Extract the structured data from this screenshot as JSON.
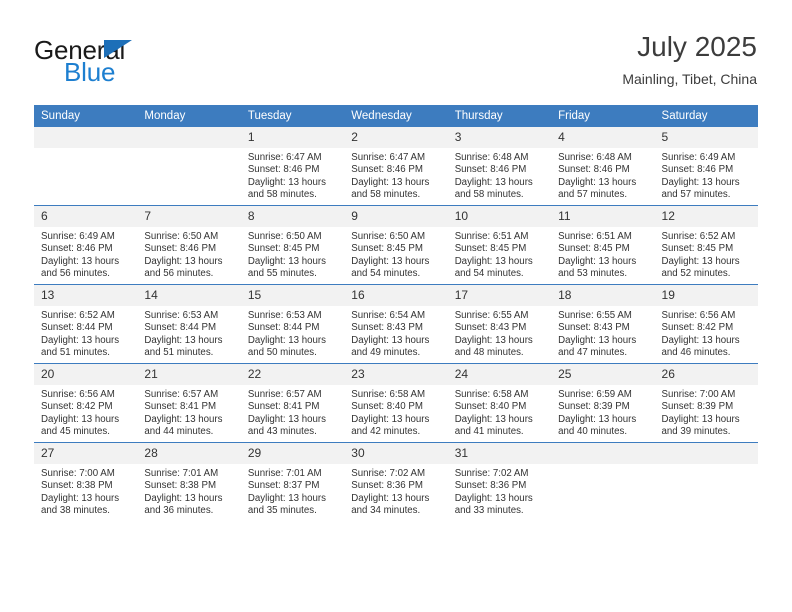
{
  "brand": {
    "name_top": "General",
    "name_bottom": "Blue",
    "accent_color": "#1d7fd0",
    "triangle_color": "#1d6fb8"
  },
  "header": {
    "title": "July 2025",
    "location": "Mainling, Tibet, China"
  },
  "theme": {
    "header_blue": "#3d7cbf",
    "daynum_bg": "#f2f2f2",
    "text": "#333333"
  },
  "weekday_headers": [
    "Sunday",
    "Monday",
    "Tuesday",
    "Wednesday",
    "Thursday",
    "Friday",
    "Saturday"
  ],
  "labels": {
    "sunrise_prefix": "Sunrise:",
    "sunset_prefix": "Sunset:",
    "daylight_prefix": "Daylight:"
  },
  "weeks": [
    [
      {
        "day": "",
        "sunrise": "",
        "sunset": "",
        "daylight": ""
      },
      {
        "day": "",
        "sunrise": "",
        "sunset": "",
        "daylight": ""
      },
      {
        "day": "1",
        "sunrise": "Sunrise: 6:47 AM",
        "sunset": "Sunset: 8:46 PM",
        "daylight": "Daylight: 13 hours and 58 minutes."
      },
      {
        "day": "2",
        "sunrise": "Sunrise: 6:47 AM",
        "sunset": "Sunset: 8:46 PM",
        "daylight": "Daylight: 13 hours and 58 minutes."
      },
      {
        "day": "3",
        "sunrise": "Sunrise: 6:48 AM",
        "sunset": "Sunset: 8:46 PM",
        "daylight": "Daylight: 13 hours and 58 minutes."
      },
      {
        "day": "4",
        "sunrise": "Sunrise: 6:48 AM",
        "sunset": "Sunset: 8:46 PM",
        "daylight": "Daylight: 13 hours and 57 minutes."
      },
      {
        "day": "5",
        "sunrise": "Sunrise: 6:49 AM",
        "sunset": "Sunset: 8:46 PM",
        "daylight": "Daylight: 13 hours and 57 minutes."
      }
    ],
    [
      {
        "day": "6",
        "sunrise": "Sunrise: 6:49 AM",
        "sunset": "Sunset: 8:46 PM",
        "daylight": "Daylight: 13 hours and 56 minutes."
      },
      {
        "day": "7",
        "sunrise": "Sunrise: 6:50 AM",
        "sunset": "Sunset: 8:46 PM",
        "daylight": "Daylight: 13 hours and 56 minutes."
      },
      {
        "day": "8",
        "sunrise": "Sunrise: 6:50 AM",
        "sunset": "Sunset: 8:45 PM",
        "daylight": "Daylight: 13 hours and 55 minutes."
      },
      {
        "day": "9",
        "sunrise": "Sunrise: 6:50 AM",
        "sunset": "Sunset: 8:45 PM",
        "daylight": "Daylight: 13 hours and 54 minutes."
      },
      {
        "day": "10",
        "sunrise": "Sunrise: 6:51 AM",
        "sunset": "Sunset: 8:45 PM",
        "daylight": "Daylight: 13 hours and 54 minutes."
      },
      {
        "day": "11",
        "sunrise": "Sunrise: 6:51 AM",
        "sunset": "Sunset: 8:45 PM",
        "daylight": "Daylight: 13 hours and 53 minutes."
      },
      {
        "day": "12",
        "sunrise": "Sunrise: 6:52 AM",
        "sunset": "Sunset: 8:45 PM",
        "daylight": "Daylight: 13 hours and 52 minutes."
      }
    ],
    [
      {
        "day": "13",
        "sunrise": "Sunrise: 6:52 AM",
        "sunset": "Sunset: 8:44 PM",
        "daylight": "Daylight: 13 hours and 51 minutes."
      },
      {
        "day": "14",
        "sunrise": "Sunrise: 6:53 AM",
        "sunset": "Sunset: 8:44 PM",
        "daylight": "Daylight: 13 hours and 51 minutes."
      },
      {
        "day": "15",
        "sunrise": "Sunrise: 6:53 AM",
        "sunset": "Sunset: 8:44 PM",
        "daylight": "Daylight: 13 hours and 50 minutes."
      },
      {
        "day": "16",
        "sunrise": "Sunrise: 6:54 AM",
        "sunset": "Sunset: 8:43 PM",
        "daylight": "Daylight: 13 hours and 49 minutes."
      },
      {
        "day": "17",
        "sunrise": "Sunrise: 6:55 AM",
        "sunset": "Sunset: 8:43 PM",
        "daylight": "Daylight: 13 hours and 48 minutes."
      },
      {
        "day": "18",
        "sunrise": "Sunrise: 6:55 AM",
        "sunset": "Sunset: 8:43 PM",
        "daylight": "Daylight: 13 hours and 47 minutes."
      },
      {
        "day": "19",
        "sunrise": "Sunrise: 6:56 AM",
        "sunset": "Sunset: 8:42 PM",
        "daylight": "Daylight: 13 hours and 46 minutes."
      }
    ],
    [
      {
        "day": "20",
        "sunrise": "Sunrise: 6:56 AM",
        "sunset": "Sunset: 8:42 PM",
        "daylight": "Daylight: 13 hours and 45 minutes."
      },
      {
        "day": "21",
        "sunrise": "Sunrise: 6:57 AM",
        "sunset": "Sunset: 8:41 PM",
        "daylight": "Daylight: 13 hours and 44 minutes."
      },
      {
        "day": "22",
        "sunrise": "Sunrise: 6:57 AM",
        "sunset": "Sunset: 8:41 PM",
        "daylight": "Daylight: 13 hours and 43 minutes."
      },
      {
        "day": "23",
        "sunrise": "Sunrise: 6:58 AM",
        "sunset": "Sunset: 8:40 PM",
        "daylight": "Daylight: 13 hours and 42 minutes."
      },
      {
        "day": "24",
        "sunrise": "Sunrise: 6:58 AM",
        "sunset": "Sunset: 8:40 PM",
        "daylight": "Daylight: 13 hours and 41 minutes."
      },
      {
        "day": "25",
        "sunrise": "Sunrise: 6:59 AM",
        "sunset": "Sunset: 8:39 PM",
        "daylight": "Daylight: 13 hours and 40 minutes."
      },
      {
        "day": "26",
        "sunrise": "Sunrise: 7:00 AM",
        "sunset": "Sunset: 8:39 PM",
        "daylight": "Daylight: 13 hours and 39 minutes."
      }
    ],
    [
      {
        "day": "27",
        "sunrise": "Sunrise: 7:00 AM",
        "sunset": "Sunset: 8:38 PM",
        "daylight": "Daylight: 13 hours and 38 minutes."
      },
      {
        "day": "28",
        "sunrise": "Sunrise: 7:01 AM",
        "sunset": "Sunset: 8:38 PM",
        "daylight": "Daylight: 13 hours and 36 minutes."
      },
      {
        "day": "29",
        "sunrise": "Sunrise: 7:01 AM",
        "sunset": "Sunset: 8:37 PM",
        "daylight": "Daylight: 13 hours and 35 minutes."
      },
      {
        "day": "30",
        "sunrise": "Sunrise: 7:02 AM",
        "sunset": "Sunset: 8:36 PM",
        "daylight": "Daylight: 13 hours and 34 minutes."
      },
      {
        "day": "31",
        "sunrise": "Sunrise: 7:02 AM",
        "sunset": "Sunset: 8:36 PM",
        "daylight": "Daylight: 13 hours and 33 minutes."
      },
      {
        "day": "",
        "sunrise": "",
        "sunset": "",
        "daylight": ""
      },
      {
        "day": "",
        "sunrise": "",
        "sunset": "",
        "daylight": ""
      }
    ]
  ]
}
